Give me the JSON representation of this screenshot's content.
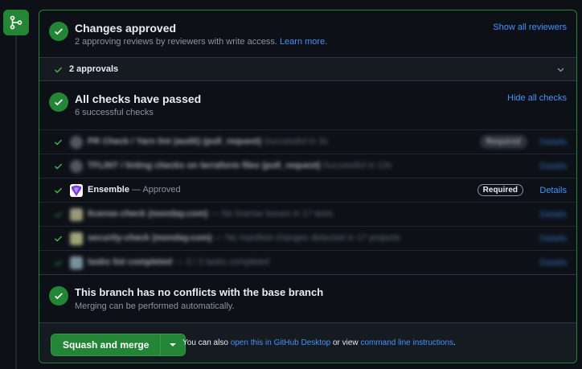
{
  "review": {
    "title": "Changes approved",
    "subtitle": "2 approving reviews by reviewers with write access.",
    "learn_more": "Learn more.",
    "show_all": "Show all reviewers"
  },
  "approvals": {
    "label": "2 approvals"
  },
  "checks": {
    "title": "All checks have passed",
    "subtitle": "6 successful checks",
    "hide_all": "Hide all checks",
    "items": [
      {
        "name": "PR Check / Yarn lint (audit) (pull_request)",
        "desc": "Successful in 3s",
        "required": "Required",
        "details": "Details",
        "blurred": true
      },
      {
        "name": "TFLINT / linting checks on terraform files (pull_request)",
        "desc": "Successful in 13s",
        "required": "",
        "details": "Details",
        "blurred": true
      },
      {
        "name": "Ensemble",
        "desc": " — Approved",
        "required": "Required",
        "details": "Details",
        "blurred": false
      },
      {
        "name": "license-check (monday.com)",
        "desc": "— No license issues in 17 tests",
        "required": "",
        "details": "Details",
        "blurred": true
      },
      {
        "name": "security-check (monday.com)",
        "desc": "— No manifest changes detected in 17 projects",
        "required": "",
        "details": "Details",
        "blurred": true
      },
      {
        "name": "tasks list completed",
        "desc": "— 3 / 3 tasks completed",
        "required": "",
        "details": "Details",
        "blurred": true
      }
    ]
  },
  "conflicts": {
    "title": "This branch has no conflicts with the base branch",
    "subtitle": "Merging can be performed automatically."
  },
  "merge": {
    "button": "Squash and merge",
    "text_prefix": "You can also ",
    "desktop_link": "open this in GitHub Desktop",
    "text_mid": " or view ",
    "cli_link": "command line instructions",
    "text_suffix": "."
  },
  "colors": {
    "success": "#238636",
    "link": "#4493f8",
    "background": "#0d1117"
  }
}
